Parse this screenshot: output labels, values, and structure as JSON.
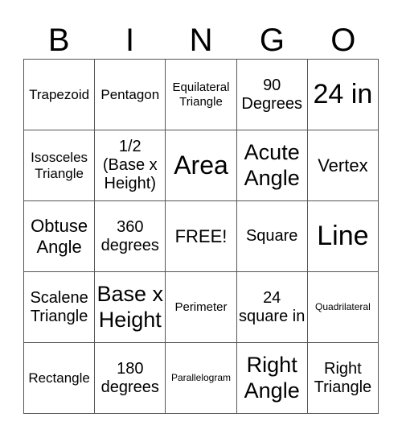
{
  "header": {
    "letters": [
      "B",
      "I",
      "N",
      "G",
      "O"
    ]
  },
  "cells": [
    [
      "Trapezoid",
      "Pentagon",
      "Equilateral Triangle",
      "90 Degrees",
      "24 in"
    ],
    [
      "Isosceles Triangle",
      "1/2 (Base x Height)",
      "Area",
      "Acute Angle",
      "Vertex"
    ],
    [
      "Obtuse Angle",
      "360 degrees",
      "FREE!",
      "Square",
      "Line"
    ],
    [
      "Scalene Triangle",
      "Base x Height",
      "Perimeter",
      "24 square in",
      "Quadrilateral"
    ],
    [
      "Rectangle",
      "180 degrees",
      "Parallelogram",
      "Right Angle",
      "Right Triangle"
    ]
  ]
}
